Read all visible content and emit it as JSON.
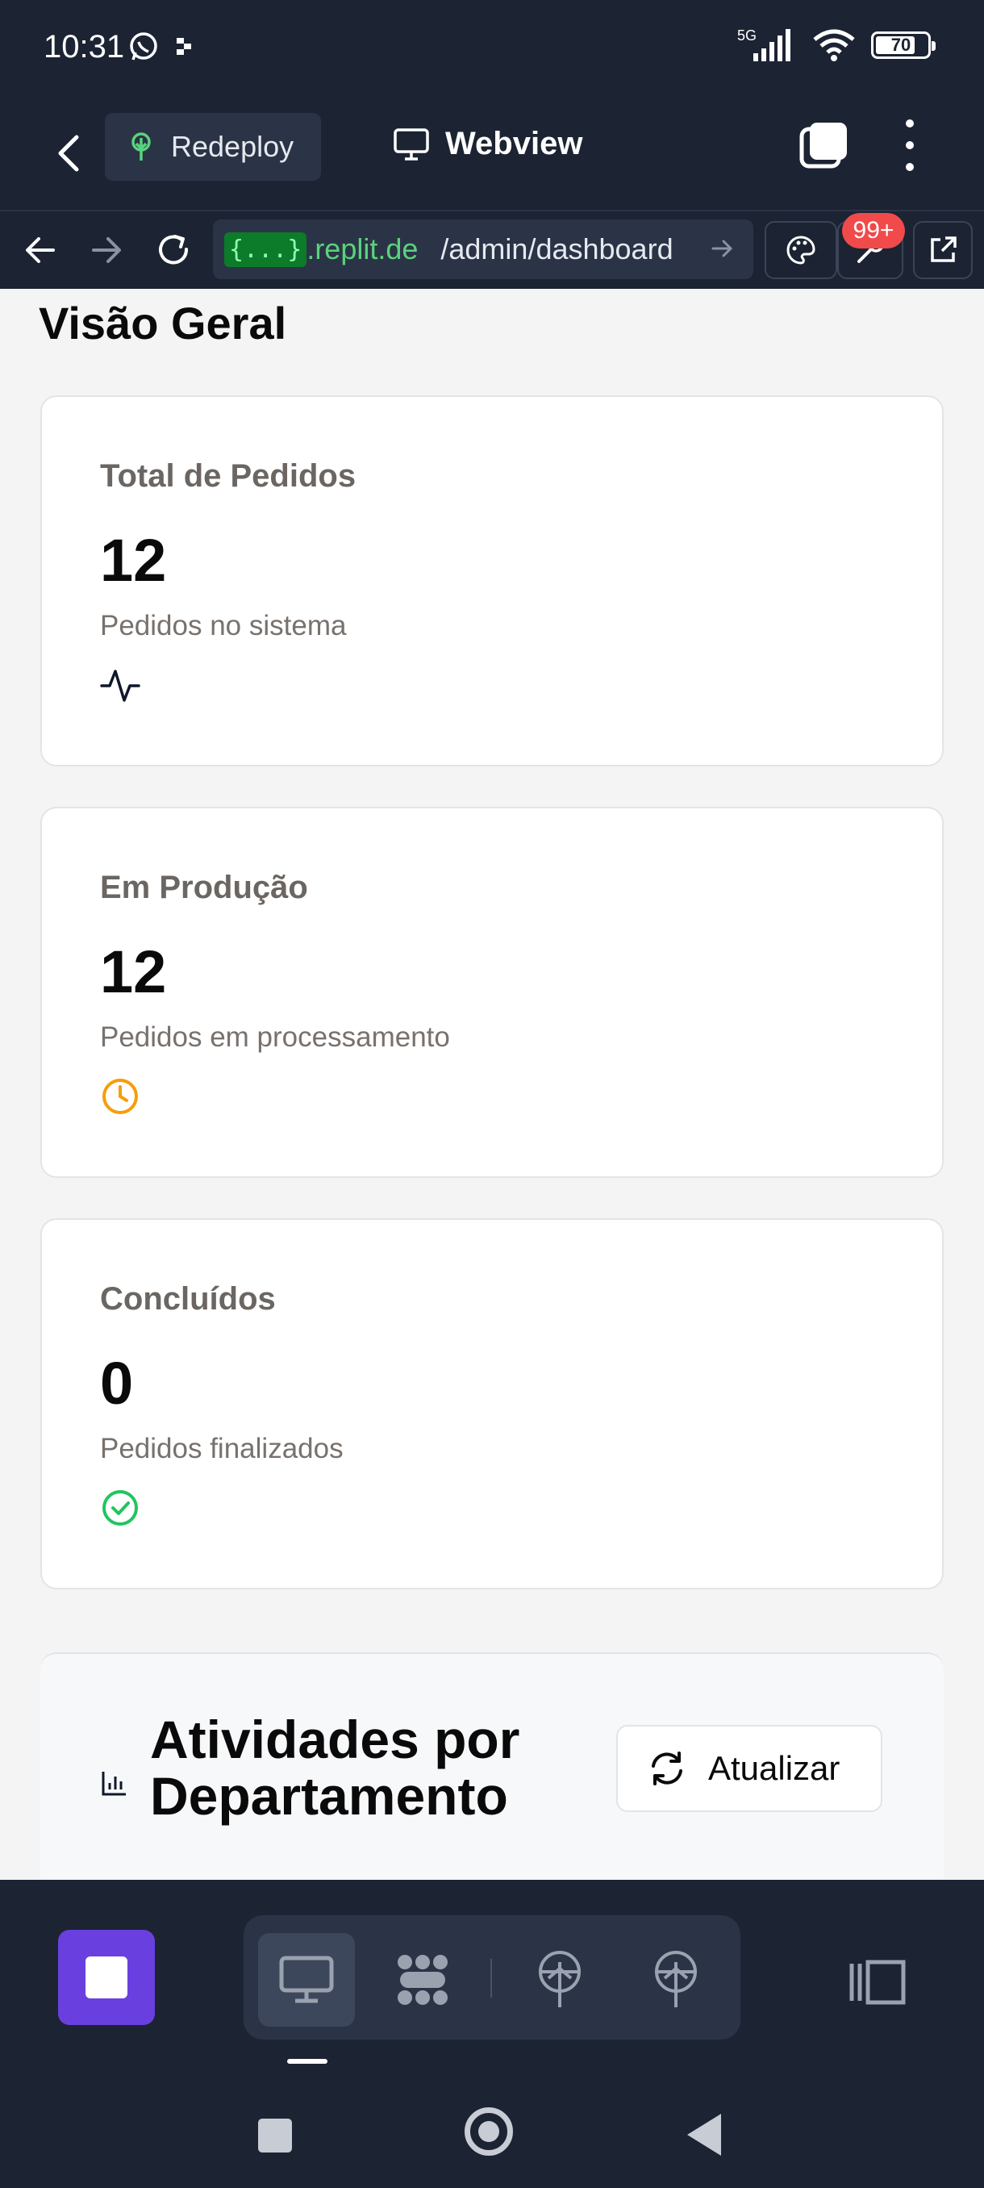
{
  "status_bar": {
    "time": "10:31",
    "network": "5G",
    "battery": "70"
  },
  "header": {
    "redeploy_label": "Redeploy",
    "webview_label": "Webview"
  },
  "url_bar": {
    "braces": "{...}",
    "domain": ".replit.de",
    "path": "/admin/dashboard",
    "badge": "99+"
  },
  "page": {
    "title": "Visão Geral",
    "cards": [
      {
        "title": "Total de Pedidos",
        "value": "12",
        "subtitle": "Pedidos no sistema",
        "icon": "activity-icon"
      },
      {
        "title": "Em Produção",
        "value": "12",
        "subtitle": "Pedidos em processamento",
        "icon": "clock-icon"
      },
      {
        "title": "Concluídos",
        "value": "0",
        "subtitle": "Pedidos finalizados",
        "icon": "check-circle-icon"
      }
    ],
    "activity": {
      "title": "Atividades por Departamento",
      "refresh_label": "Atualizar"
    }
  },
  "colors": {
    "app_bg": "#1c2333",
    "stop_button": "#6a3fe0",
    "clock": "#f59e0b",
    "check": "#22c55e",
    "badge": "#f14a4a"
  }
}
